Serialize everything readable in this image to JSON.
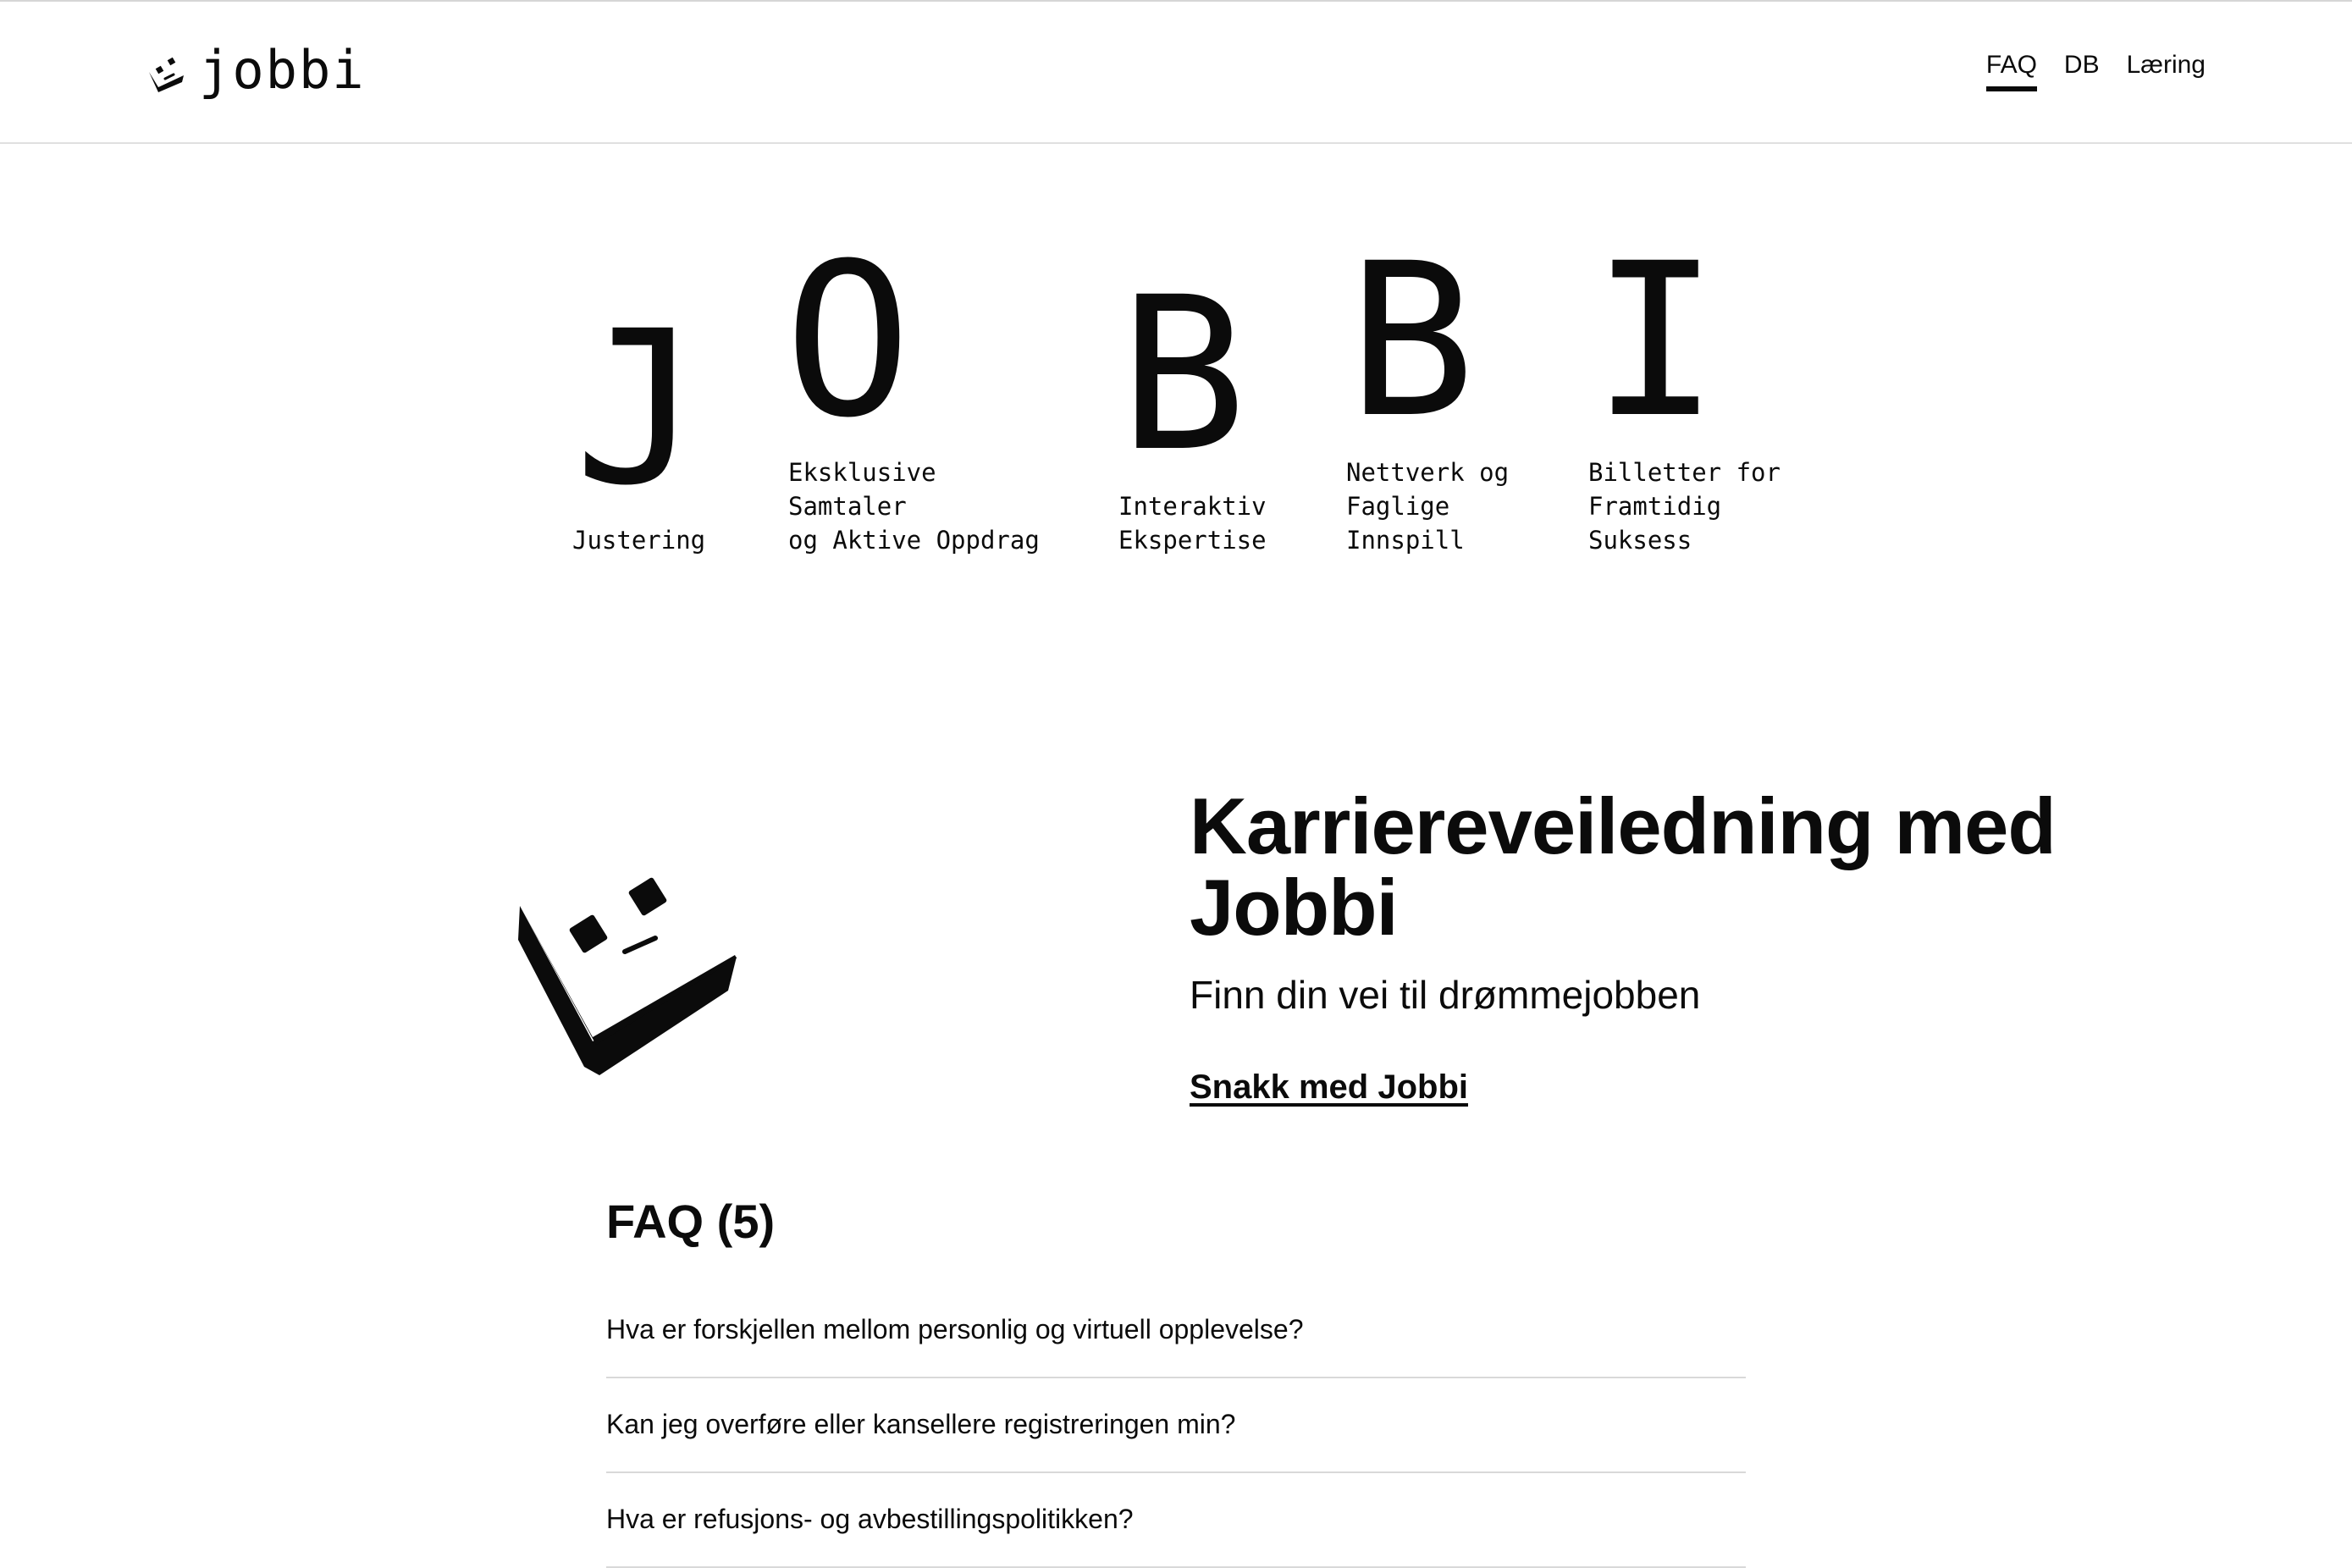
{
  "brand": {
    "name": "jobbi",
    "logo_icon": "smiley-cube-icon"
  },
  "nav": {
    "items": [
      {
        "label": "FAQ",
        "active": true
      },
      {
        "label": "DB",
        "active": false
      },
      {
        "label": "Læring",
        "active": false
      }
    ]
  },
  "acronym": [
    {
      "letter": "J",
      "caption": "Justering"
    },
    {
      "letter": "O",
      "caption": "Eksklusive\nSamtaler\nog Aktive Oppdrag"
    },
    {
      "letter": "B",
      "caption": "Interaktiv\nEkspertise"
    },
    {
      "letter": "B",
      "caption": "Nettverk og\nFaglige\nInnspill"
    },
    {
      "letter": "I",
      "caption": "Billetter for\nFramtidig\nSuksess"
    }
  ],
  "hero": {
    "icon": "smiley-cube-icon",
    "title": "Karriereveiledning med Jobbi",
    "subtitle": "Finn din vei til drømmejobben",
    "cta_label": "Snakk med Jobbi"
  },
  "faq": {
    "title": "FAQ (5)",
    "questions": [
      "Hva er forskjellen mellom personlig og virtuell opplevelse?",
      "Kan jeg overføre eller kansellere registreringen min?",
      "Hva er refusjons- og avbestillingspolitikken?"
    ]
  }
}
